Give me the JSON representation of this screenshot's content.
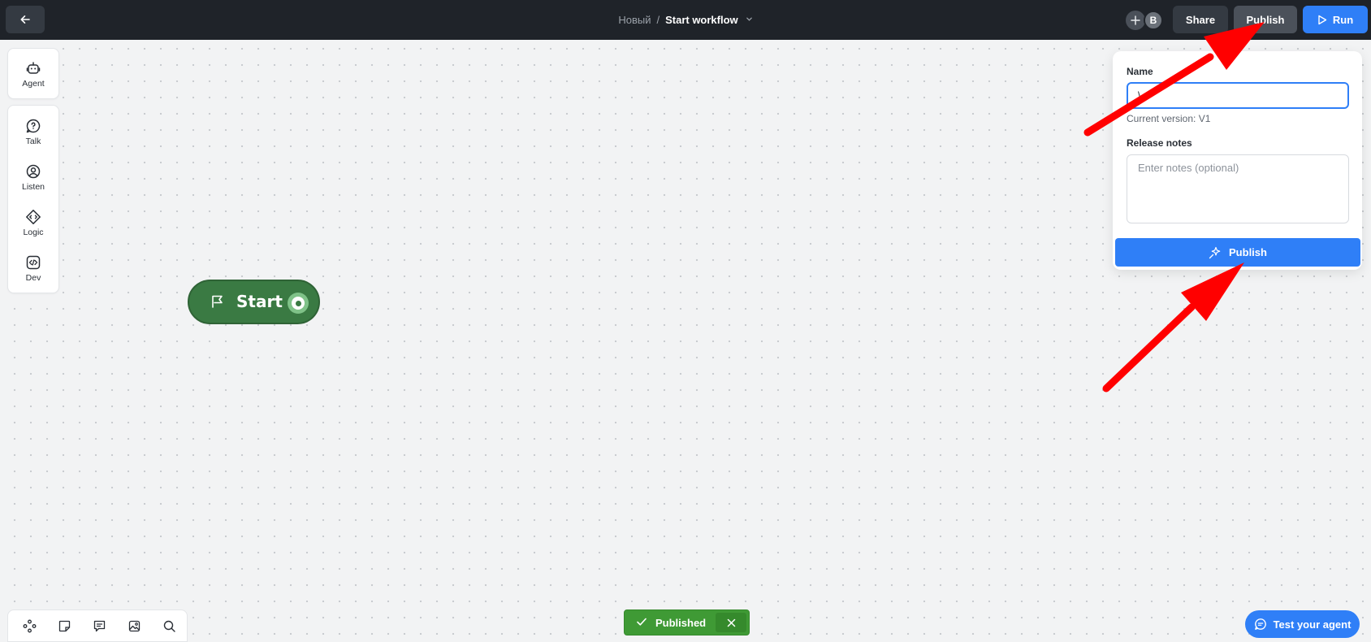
{
  "header": {
    "back_icon": "arrow-left-icon",
    "breadcrumb_parent": "Новый",
    "breadcrumb_separator": "/",
    "title": "Start workflow",
    "title_menu_icon": "chevron-down-icon",
    "add_collaborator_icon": "plus-icon",
    "avatar_initial": "B",
    "share_label": "Share",
    "publish_label": "Publish",
    "run_label": "Run",
    "run_icon": "play-icon"
  },
  "sidebar": {
    "agent": {
      "label": "Agent",
      "icon": "robot-icon"
    },
    "items": [
      {
        "label": "Talk",
        "icon": "speech-bubble-icon"
      },
      {
        "label": "Listen",
        "icon": "user-circle-icon"
      },
      {
        "label": "Logic",
        "icon": "diamond-arrows-icon"
      },
      {
        "label": "Dev",
        "icon": "code-icon"
      }
    ]
  },
  "canvas": {
    "start_node": {
      "label": "Start",
      "icon": "flag-icon"
    }
  },
  "publish_panel": {
    "name_label": "Name",
    "name_value": "\\",
    "current_version": "Current version: V1",
    "notes_label": "Release notes",
    "notes_placeholder": "Enter notes (optional)",
    "publish_button": "Publish",
    "publish_icon": "sparkle-icon"
  },
  "bottom_toolbar": {
    "icons": [
      "nodes-icon",
      "sticky-note-icon",
      "comment-icon",
      "image-icon",
      "search-icon"
    ]
  },
  "toast": {
    "message": "Published",
    "status_icon": "check-icon",
    "close_icon": "close-icon",
    "color": "#3f9a35"
  },
  "test_agent": {
    "label": "Test your agent",
    "icon": "chat-icon"
  },
  "colors": {
    "accent": "#2f7ff7",
    "topbar": "#1f2329",
    "start_node": "#3a7a43",
    "annotation_arrow": "#ff0000"
  }
}
